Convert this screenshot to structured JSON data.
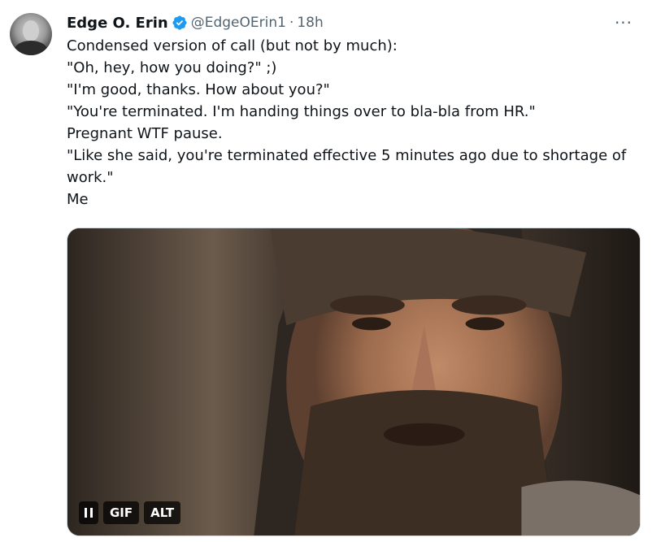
{
  "tweet": {
    "author_name": "Edge O. Erin",
    "handle": "@EdgeOErin1",
    "separator": "·",
    "time": "18h",
    "more_label": "···",
    "lines": [
      "Condensed version of call (but not by much):",
      "\"Oh, hey, how you doing?\" ;)",
      "\"I'm good, thanks. How about you?\"",
      "\"You're terminated. I'm handing things over to bla-bla from HR.\"",
      "Pregnant WTF pause.",
      "\"Like she said, you're terminated effective 5 minutes ago due to shortage of work.\"",
      "Me"
    ],
    "media": {
      "gif_label": "GIF",
      "alt_label": "ALT"
    }
  },
  "colors": {
    "text": "#0f1419",
    "secondary": "#536471",
    "verified": "#1d9bf0",
    "border": "#cfd9de"
  },
  "icons": {
    "verified": "verified-badge-icon",
    "more": "more-options-icon",
    "pause": "pause-icon"
  }
}
